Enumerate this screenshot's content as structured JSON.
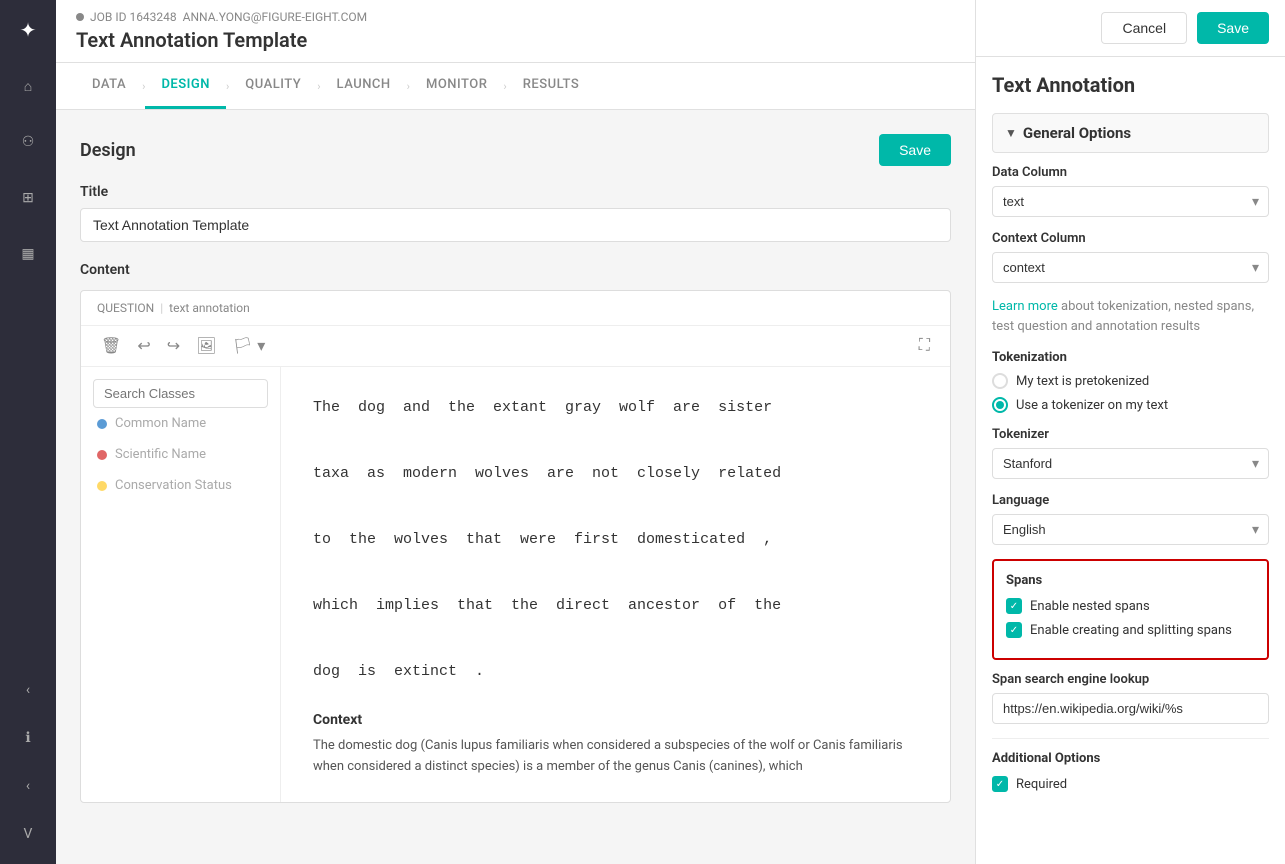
{
  "sidebar": {
    "icons": [
      {
        "name": "logo-icon",
        "symbol": "✦"
      },
      {
        "name": "home-icon",
        "symbol": "⌂"
      },
      {
        "name": "people-icon",
        "symbol": "⚇"
      },
      {
        "name": "monitor-icon",
        "symbol": "⊞"
      },
      {
        "name": "chart-icon",
        "symbol": "▦"
      }
    ],
    "bottom_icons": [
      {
        "name": "chevron-left-icon",
        "symbol": "‹"
      },
      {
        "name": "info-icon",
        "symbol": "ℹ"
      },
      {
        "name": "chevron-left-bottom-icon",
        "symbol": "‹"
      },
      {
        "name": "user-icon",
        "symbol": "V"
      }
    ]
  },
  "top_bar": {
    "job_id": "JOB ID 1643248",
    "email": "ANNA.YONG@FIGURE-EIGHT.COM",
    "page_title": "Text Annotation Template"
  },
  "nav": {
    "tabs": [
      {
        "label": "DATA",
        "active": false
      },
      {
        "label": "DESIGN",
        "active": true
      },
      {
        "label": "QUALITY",
        "active": false
      },
      {
        "label": "LAUNCH",
        "active": false
      },
      {
        "label": "MONITOR",
        "active": false
      },
      {
        "label": "RESULTS",
        "active": false
      }
    ]
  },
  "design": {
    "section_title": "Design",
    "save_button": "Save",
    "title_label": "Title",
    "title_value": "Text Annotation Template",
    "content_label": "Content"
  },
  "widget": {
    "header_question": "QUESTION",
    "header_type": "text annotation",
    "search_placeholder": "Search Classes",
    "classes": [
      {
        "label": "Common Name",
        "color_class": "dot-blue"
      },
      {
        "label": "Scientific Name",
        "color_class": "dot-red"
      },
      {
        "label": "Conservation Status",
        "color_class": "dot-yellow"
      }
    ],
    "annotation_text": "The dog and the extant gray wolf are sister taxa as modern wolves are not closely related to the wolves that were first domesticated , which implies that the direct ancestor of the dog is extinct .",
    "context_title": "Context",
    "context_text": "The domestic dog (Canis lupus familiaris when considered a subspecies of the wolf or Canis familiaris when considered a distinct species) is a member of the genus Canis (canines), which"
  },
  "right_panel": {
    "cancel_label": "Cancel",
    "save_label": "Save",
    "title": "Text Annotation",
    "general_options_label": "General Options",
    "data_column_label": "Data Column",
    "data_column_value": "text",
    "context_column_label": "Context Column",
    "context_column_value": "context",
    "learn_more_text": "Learn more",
    "learn_more_suffix": " about tokenization, nested spans, test question and annotation results",
    "tokenization_label": "Tokenization",
    "radio_pretokenized": "My text is pretokenized",
    "radio_tokenizer": "Use a tokenizer on my text",
    "tokenizer_label": "Tokenizer",
    "tokenizer_value": "Stanford",
    "language_label": "Language",
    "language_value": "English",
    "spans_label": "Spans",
    "enable_nested_spans": "Enable nested spans",
    "enable_creating_splitting": "Enable creating and splitting spans",
    "span_search_label": "Span search engine lookup",
    "span_search_value": "https://en.wikipedia.org/wiki/%s",
    "additional_options_label": "Additional Options",
    "required_label": "Required"
  }
}
